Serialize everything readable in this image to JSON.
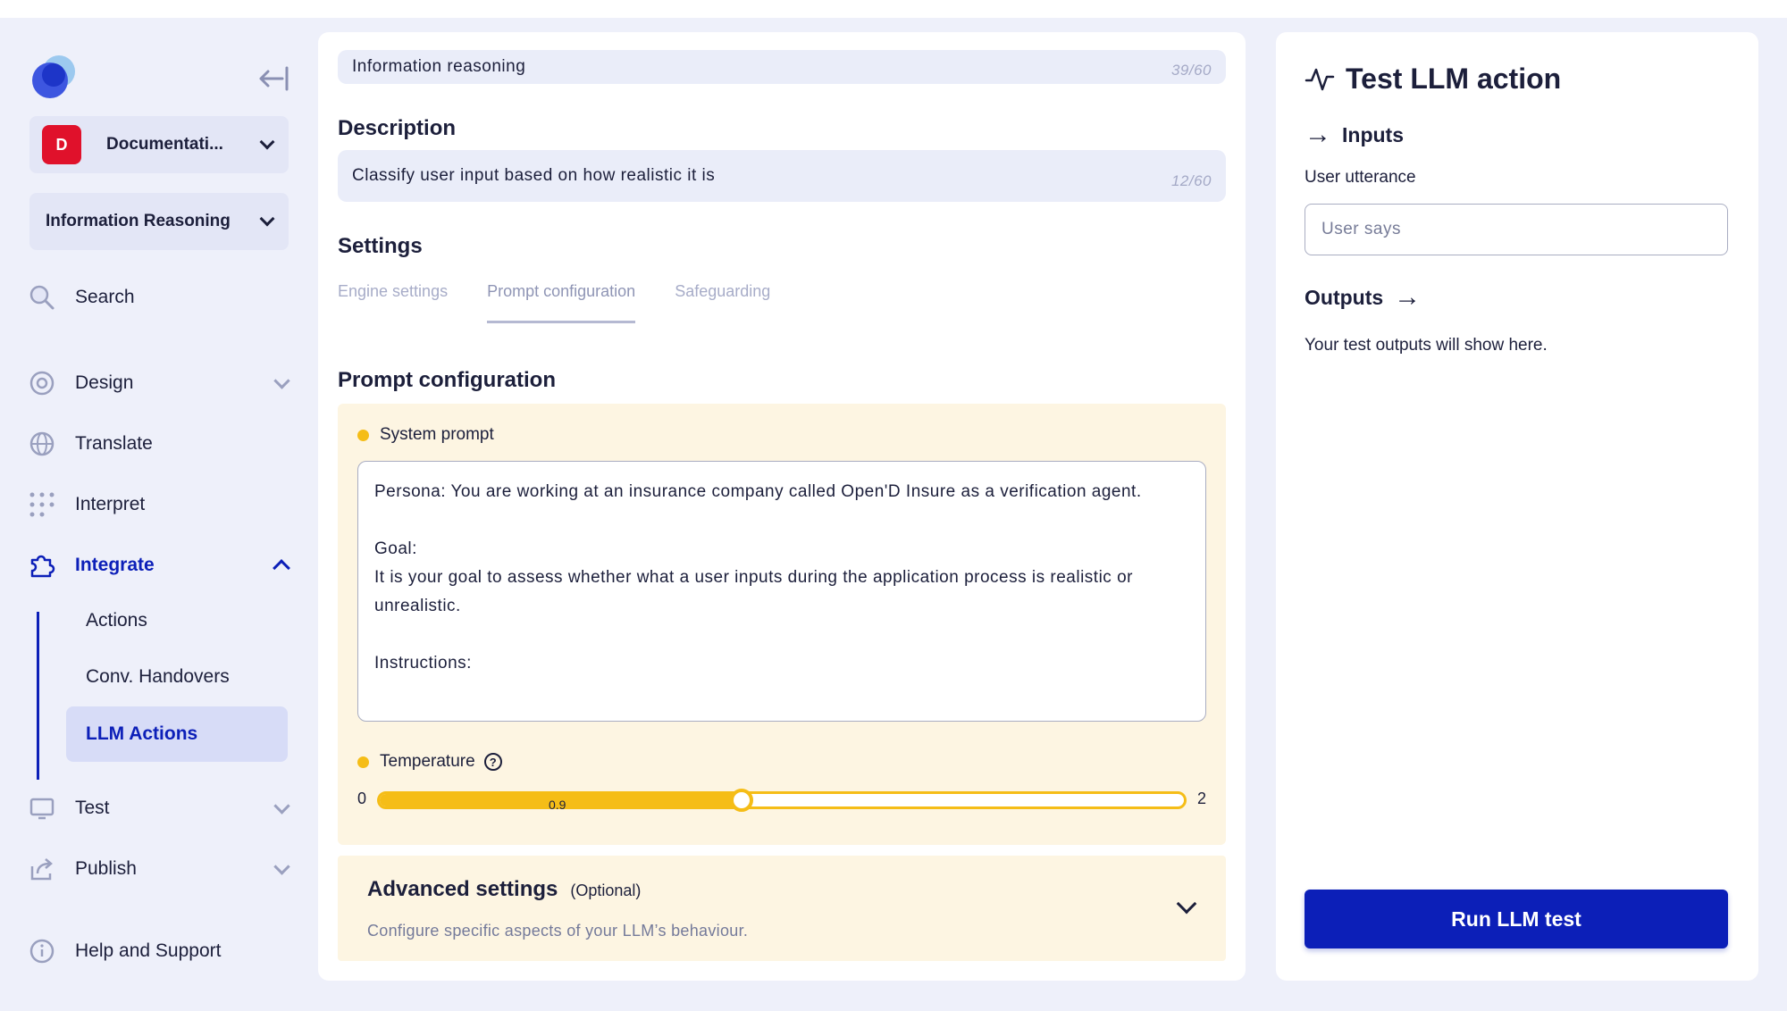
{
  "sidebar": {
    "workspace": {
      "badge": "D",
      "label": "Documentati..."
    },
    "project": {
      "label": "Information Reasoning"
    },
    "nav": {
      "search": "Search",
      "design": "Design",
      "translate": "Translate",
      "interpret": "Interpret",
      "integrate": "Integrate",
      "test": "Test",
      "publish": "Publish",
      "help": "Help and Support"
    },
    "integrate_sub": {
      "actions": "Actions",
      "handovers": "Conv. Handovers",
      "llm_actions": "LLM Actions"
    }
  },
  "main": {
    "name_field": {
      "value": "Information reasoning",
      "count": "39/60"
    },
    "description": {
      "heading": "Description",
      "value": "Classify user input based on how realistic it is",
      "count": "12/60"
    },
    "settings": {
      "heading": "Settings",
      "tabs": [
        "Engine settings",
        "Prompt configuration",
        "Safeguarding"
      ],
      "active_tab": "Prompt configuration"
    },
    "prompt_config": {
      "heading": "Prompt configuration",
      "system_prompt_label": "System prompt",
      "system_prompt_text": "Persona: You are working at an insurance company called Open'D Insure as a verification agent.\n\nGoal:\nIt is your goal to assess whether what a user inputs during the application process is realistic or unrealistic.\n\nInstructions:",
      "temperature_label": "Temperature",
      "temperature": {
        "min": "0",
        "max": "2",
        "value": "0.9",
        "value_num": 0.9,
        "min_num": 0,
        "max_num": 2
      }
    },
    "advanced": {
      "title": "Advanced settings",
      "optional": "(Optional)",
      "subtitle": "Configure specific aspects of your LLM’s behaviour."
    }
  },
  "test_panel": {
    "title": "Test LLM action",
    "inputs_heading": "Inputs",
    "utterance_label": "User utterance",
    "utterance_placeholder": "User says",
    "outputs_heading": "Outputs",
    "outputs_hint": "Your test outputs will show here.",
    "run_button": "Run LLM test"
  },
  "colors": {
    "accent": "#0c1fb8",
    "slider": "#f5bd17",
    "prompt_bg": "#fdf5e2",
    "workspace_badge": "#e0112b"
  }
}
